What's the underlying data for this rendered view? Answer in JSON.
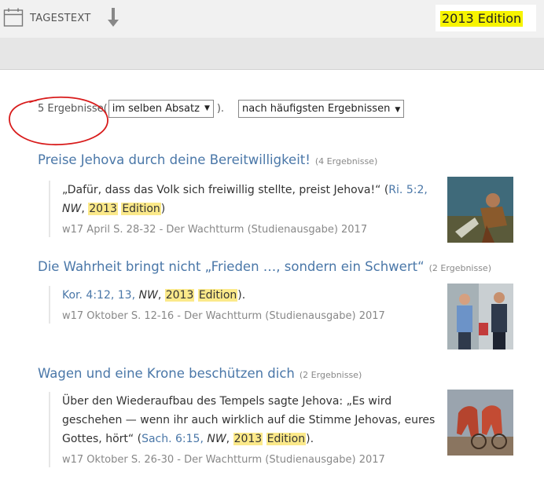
{
  "toolbar": {
    "daily_text_label": "TAGESTEXT",
    "search_value": "2013 Edition"
  },
  "results_summary": {
    "count": "5 Ergebnisse",
    "open_paren": "(",
    "scope_select": "im selben Absatz",
    "close_paren": ").",
    "sort_select": "nach häufigsten Ergebnissen"
  },
  "results": [
    {
      "title": "Preise Jehova durch deine Bereitwilligkeit!",
      "count": "(4 Ergebnisse)",
      "snippet": {
        "pre": "„Dafür, dass das Volk sich freiwillig stellte, preist Jehova!“ (",
        "ref": "Ri. 5:2,",
        "nw": "NW",
        "hl1": "2013",
        "hl2": "Edition",
        "post": ")"
      },
      "source": "w17 April S. 28-32 - Der Wachtturm (Studienausgabe) 2017"
    },
    {
      "title": "Die Wahrheit bringt nicht „Frieden …, sondern ein Schwert“",
      "count": "(2 Ergebnisse)",
      "snippet": {
        "pre": "",
        "ref": "Kor. 4:12, 13,",
        "nw": "NW",
        "hl1": "2013",
        "hl2": "Edition",
        "post": ")."
      },
      "source": "w17 Oktober S. 12-16 - Der Wachtturm (Studienausgabe) 2017"
    },
    {
      "title": "Wagen und eine Krone beschützen dich",
      "count": "(2 Ergebnisse)",
      "snippet": {
        "pre": "Über den Wiederaufbau des Tempels sagte Jehova: „Es wird geschehen — wenn ihr auch wirklich auf die Stimme Jehovas, eures Gottes, hört“ (",
        "ref": "Sach. 6:15,",
        "nw": "NW",
        "hl1": "2013",
        "hl2": "Edition",
        "post": ")."
      },
      "source": "w17 Oktober S. 26-30 - Der Wachtturm (Studienausgabe) 2017"
    }
  ],
  "colors": {
    "link": "#4a77a8",
    "highlight": "#fbe98a",
    "search_highlight": "#f7f400",
    "annotation": "#d81b1b"
  },
  "icons": {
    "calendar": "calendar-icon",
    "download": "download-arrow-icon"
  }
}
